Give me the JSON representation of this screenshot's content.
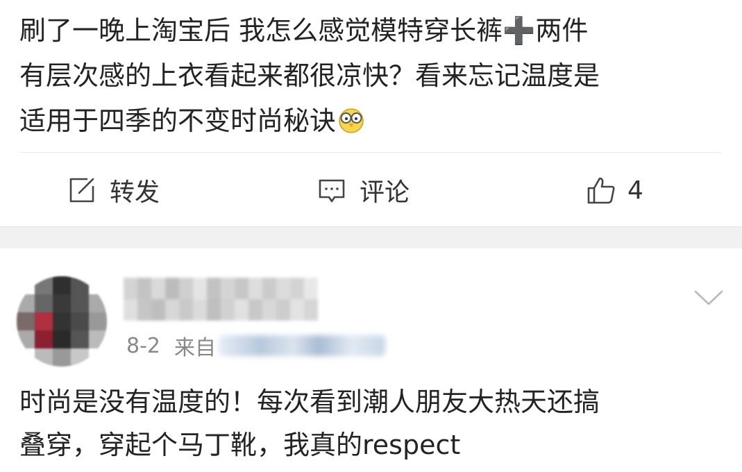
{
  "post": {
    "line1_before": "刷了一晚上淘宝后 我怎么感觉模特穿长裤",
    "plus_symbol": "➕",
    "line1_after": "两件",
    "line2": "有层次感的上衣看起来都很凉快？看来忘记温度是",
    "line3": "适用于四季的不变时尚秘诀",
    "emoji": "glasses-face-emoji"
  },
  "actions": {
    "repost": {
      "label": "转发",
      "icon": "repost-icon"
    },
    "comment": {
      "label": "评论",
      "icon": "comment-icon"
    },
    "like": {
      "label": "4",
      "icon": "thumbs-up-icon"
    }
  },
  "comment": {
    "date": "8-2",
    "source_prefix": "来自",
    "text_line1": "时尚是没有温度的！每次看到潮人朋友大热天还搞",
    "text_line2": "叠穿，穿起个马丁靴，我真的respect",
    "expand_icon": "chevron-down-icon"
  },
  "colors": {
    "text": "#232323",
    "meta": "#888888",
    "separator": "#f1f1f1"
  }
}
